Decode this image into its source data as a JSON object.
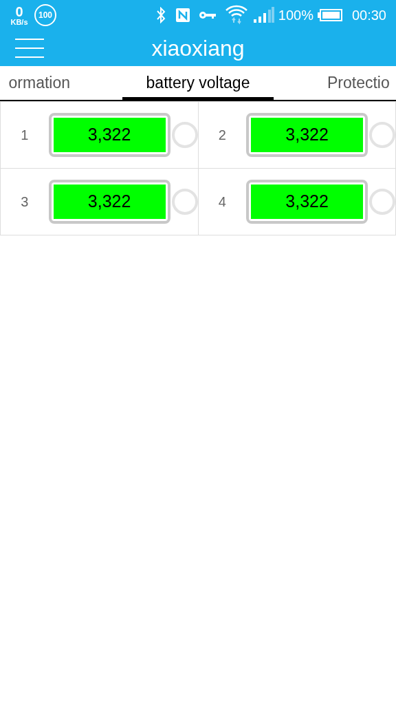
{
  "status_bar": {
    "speed": "0",
    "speed_unit": "KB/s",
    "badge": "100",
    "battery": "100%",
    "time": "00:30"
  },
  "app_bar": {
    "title": "xiaoxiang"
  },
  "tabs": [
    {
      "label": "ormation",
      "selected": false
    },
    {
      "label": "battery voltage",
      "selected": true
    },
    {
      "label": "Protectio",
      "selected": false
    }
  ],
  "cells": [
    {
      "index": "1",
      "voltage": "3,322",
      "balancing": false
    },
    {
      "index": "2",
      "voltage": "3,322",
      "balancing": false
    },
    {
      "index": "3",
      "voltage": "3,322",
      "balancing": false
    },
    {
      "index": "4",
      "voltage": "3,322",
      "balancing": false
    }
  ]
}
